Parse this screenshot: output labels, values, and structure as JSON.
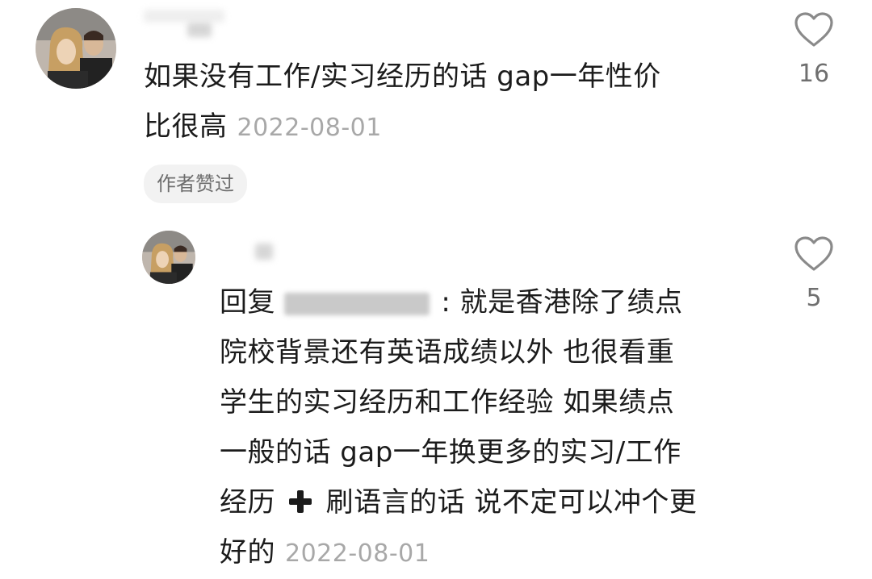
{
  "comment": {
    "text": "如果没有工作/实习经历的话 gap一年性价比很高",
    "line1": "如果没有工作/实习经历的话 gap一年性价",
    "line2": "比很高",
    "date": "2022-08-01",
    "badge": "作者赞过",
    "like_count": "16"
  },
  "reply": {
    "prefix": "回复",
    "after_name": ": 就是香港除了绩点",
    "lines": [
      "院校背景还有英语成绩以外 也很看重",
      "学生的实习经历和工作经验 如果绩点",
      "一般的话 gap一年换更多的实习/工作"
    ],
    "line5_before": "经历",
    "line5_after": "刷语言的话 说不定可以冲个更",
    "line6": "好的",
    "date": "2022-08-01",
    "like_count": "5"
  },
  "icons": {
    "like": "heart-outline-icon",
    "plus": "plus-emoji-icon"
  },
  "colors": {
    "text": "#1b1b1b",
    "date": "#a8a8a8",
    "badge_bg": "#f2f2f2",
    "badge_text": "#6e6e6e",
    "like_icon": "#8a8a8a"
  }
}
